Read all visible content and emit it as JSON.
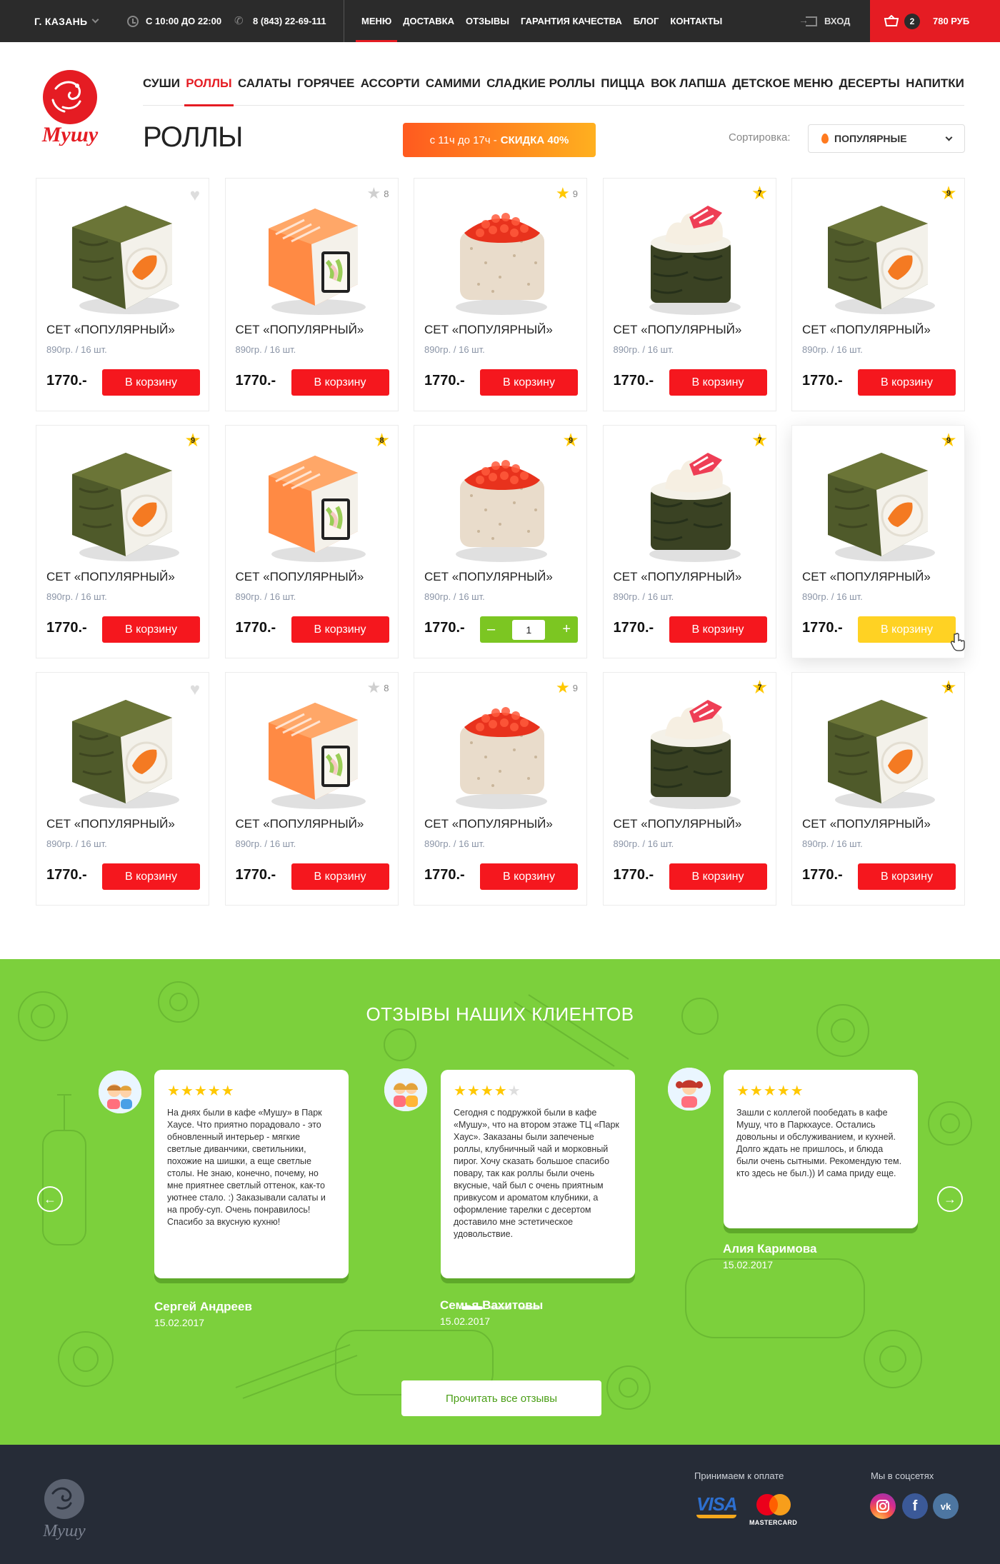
{
  "topbar": {
    "city": "Г. КАЗАНЬ",
    "hours": "С 10:00 ДО 22:00",
    "phone": "8 (843) 22-69-111",
    "nav": [
      "МЕНЮ",
      "ДОСТАВКА",
      "ОТЗЫВЫ",
      "ГАРАНТИЯ КАЧЕСТВА",
      "БЛОГ",
      "КОНТАКТЫ"
    ],
    "active_nav": "МЕНЮ",
    "login": "ВХОД",
    "cart_count": "2",
    "cart_sum": "780 РУБ"
  },
  "brand": {
    "logo_text": "Мушу",
    "accent": "#e51c23"
  },
  "categories": [
    "СУШИ",
    "РОЛЛЫ",
    "САЛАТЫ",
    "ГОРЯЧЕЕ",
    "АССОРТИ",
    "САМИМИ",
    "СЛАДКИЕ РОЛЛЫ",
    "ПИЦЦА",
    "ВОК ЛАПША",
    "ДЕТСКОЕ МЕНЮ",
    "ДЕСЕРТЫ",
    "НАПИТКИ"
  ],
  "active_category": "РОЛЛЫ",
  "page_title": "РОЛЛЫ",
  "promo": {
    "prefix": "с 11ч до 17ч -",
    "highlight": "СКИДКА 40%"
  },
  "sort": {
    "label": "Сортировка:",
    "value": "ПОПУЛЯРНЫЕ"
  },
  "products": [
    {
      "name": "СЕТ «ПОПУЛЯРНЫЙ»",
      "weight": "890гр. / 16 шт.",
      "price": "1770.-",
      "button": "В корзину",
      "image": "nori-salmon-roll",
      "marker": "heart"
    },
    {
      "name": "СЕТ «ПОПУЛЯРНЫЙ»",
      "weight": "890гр. / 16 шт.",
      "price": "1770.-",
      "button": "В корзину",
      "image": "salmon-roll",
      "marker": "star-grey",
      "rating": "8"
    },
    {
      "name": "СЕТ «ПОПУЛЯРНЫЙ»",
      "weight": "890гр. / 16 шт.",
      "price": "1770.-",
      "button": "В корзину",
      "image": "caviar-roll",
      "marker": "star-gold",
      "rating": "9"
    },
    {
      "name": "СЕТ «ПОПУЛЯРНЫЙ»",
      "weight": "890гр. / 16 шт.",
      "price": "1770.-",
      "button": "В корзину",
      "image": "gunkan-roll",
      "marker": "badge",
      "rating": "7"
    },
    {
      "name": "СЕТ «ПОПУЛЯРНЫЙ»",
      "weight": "890гр. / 16 шт.",
      "price": "1770.-",
      "button": "В корзину",
      "image": "nori-salmon-roll",
      "marker": "badge",
      "rating": "9"
    },
    {
      "name": "СЕТ «ПОПУЛЯРНЫЙ»",
      "weight": "890гр. / 16 шт.",
      "price": "1770.-",
      "button": "В корзину",
      "image": "nori-salmon-roll",
      "marker": "badge",
      "rating": "9"
    },
    {
      "name": "СЕТ «ПОПУЛЯРНЫЙ»",
      "weight": "890гр. / 16 шт.",
      "price": "1770.-",
      "button": "В корзину",
      "image": "salmon-roll",
      "marker": "badge",
      "rating": "8"
    },
    {
      "name": "СЕТ «ПОПУЛЯРНЫЙ»",
      "weight": "890гр. / 16 шт.",
      "price": "1770.-",
      "button": "",
      "image": "caviar-roll",
      "marker": "badge",
      "rating": "9",
      "stepper": {
        "minus": "–",
        "qty": "1",
        "plus": "+"
      }
    },
    {
      "name": "СЕТ «ПОПУЛЯРНЫЙ»",
      "weight": "890гр. / 16 шт.",
      "price": "1770.-",
      "button": "В корзину",
      "image": "gunkan-roll",
      "marker": "badge",
      "rating": "7"
    },
    {
      "name": "СЕТ «ПОПУЛЯРНЫЙ»",
      "weight": "890гр. / 16 шт.",
      "price": "1770.-",
      "button": "В корзину",
      "image": "nori-salmon-roll",
      "marker": "badge",
      "rating": "9",
      "hover": true
    },
    {
      "name": "СЕТ «ПОПУЛЯРНЫЙ»",
      "weight": "890гр. / 16 шт.",
      "price": "1770.-",
      "button": "В корзину",
      "image": "nori-salmon-roll",
      "marker": "heart"
    },
    {
      "name": "СЕТ «ПОПУЛЯРНЫЙ»",
      "weight": "890гр. / 16 шт.",
      "price": "1770.-",
      "button": "В корзину",
      "image": "salmon-roll",
      "marker": "star-grey",
      "rating": "8"
    },
    {
      "name": "СЕТ «ПОПУЛЯРНЫЙ»",
      "weight": "890гр. / 16 шт.",
      "price": "1770.-",
      "button": "В корзину",
      "image": "caviar-roll",
      "marker": "star-gold",
      "rating": "9"
    },
    {
      "name": "СЕТ «ПОПУЛЯРНЫЙ»",
      "weight": "890гр. / 16 шт.",
      "price": "1770.-",
      "button": "В корзину",
      "image": "gunkan-roll",
      "marker": "badge",
      "rating": "7"
    },
    {
      "name": "СЕТ «ПОПУЛЯРНЫЙ»",
      "weight": "890гр. / 16 шт.",
      "price": "1770.-",
      "button": "В корзину",
      "image": "nori-salmon-roll",
      "marker": "badge",
      "rating": "9"
    }
  ],
  "reviews": {
    "title": "ОТЗЫВЫ НАШИХ КЛИЕНТОВ",
    "items": [
      {
        "stars": 5,
        "text": "На днях были в кафе «Мушу» в Парк Хаусе. Что приятно порадовало - это обновленный интерьер - мягкие светлые диванчики, светильники, похожие на шишки, а еще светлые столы. Не знаю, конечно, почему, но мне приятнее светлый оттенок, как-то уютнее стало. :) Заказывали салаты и на пробу-суп. Очень понравилось! Спасибо за вкусную кухню!",
        "author": "Сергей Андреев",
        "date": "15.02.2017"
      },
      {
        "stars": 4,
        "text": "Сегодня с подружкой были в кафе «Мушу», что на втором этаже ТЦ «Парк Хаус». Заказаны были запеченые роллы, клубничный чай и морковный пирог. Хочу сказать большое спасибо повару, так как роллы были очень вкусные, чай был с очень приятным привкусом и ароматом клубники, а оформление тарелки с десертом доставило мне эстетическое удовольствие.",
        "author": "Семья Вахитовы",
        "date": "15.02.2017"
      },
      {
        "stars": 5,
        "text": "Зашли с коллегой пообедать в кафе Мушу, что в Паркхаусе. Остались довольны и обслуживанием, и кухней. Долго ждать не пришлось, и блюда были очень сытными. Рекомендую тем. кто здесь не был.)) И сама приду еще.",
        "author": "Алия Каримова",
        "date": "15.02.2017"
      }
    ],
    "read_all": "Прочитать все отзывы",
    "green": "#7cd03c"
  },
  "footer": {
    "pay_label": "Принимаем к оплате",
    "visa": "VISA",
    "mastercard": "MASTERCARD",
    "social_label": "Мы в соцсетях",
    "social": [
      "instagram-icon",
      "facebook-icon",
      "vk-icon"
    ]
  }
}
